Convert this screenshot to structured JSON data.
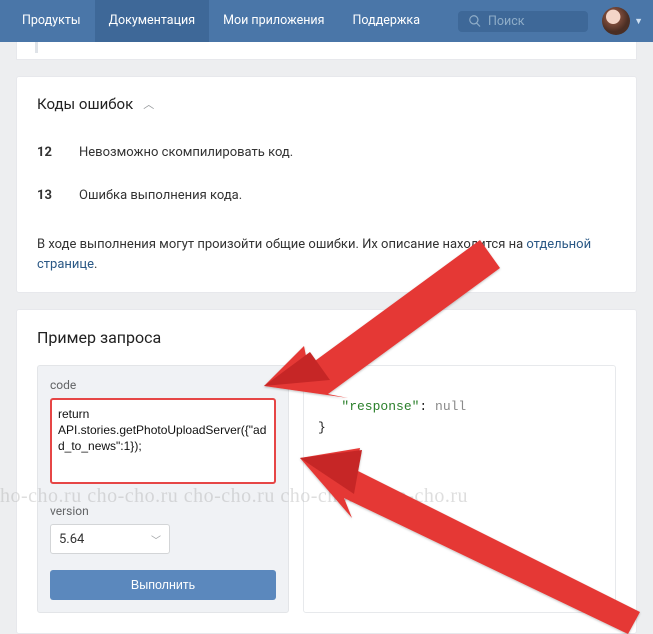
{
  "nav": {
    "items": [
      "Продукты",
      "Документация",
      "Мои приложения",
      "Поддержка"
    ],
    "active_index": 1,
    "search_placeholder": "Поиск"
  },
  "errors_section": {
    "title": "Коды ошибок",
    "rows": [
      {
        "code": "12",
        "text": "Невозможно скомпилировать код."
      },
      {
        "code": "13",
        "text": "Ошибка выполнения кода."
      }
    ],
    "footer_prefix": "В ходе выполнения могут произойти общие ошибки. Их описание находится на ",
    "footer_link": "отдельной странице",
    "footer_suffix": "."
  },
  "example_section": {
    "title": "Пример запроса",
    "code_label": "code",
    "code_value": "return API.stories.getPhotoUploadServer({\"add_to_news\":1});",
    "version_label": "version",
    "version_value": "5.64",
    "execute_label": "Выполнить",
    "response": {
      "open": "{",
      "key": "\"response\"",
      "sep": ": ",
      "val": "null",
      "close": "}"
    }
  },
  "watermark": "ho-cho.ru cho-cho.ru cho-cho.ru cho-cho.ru cho-cho.ru"
}
